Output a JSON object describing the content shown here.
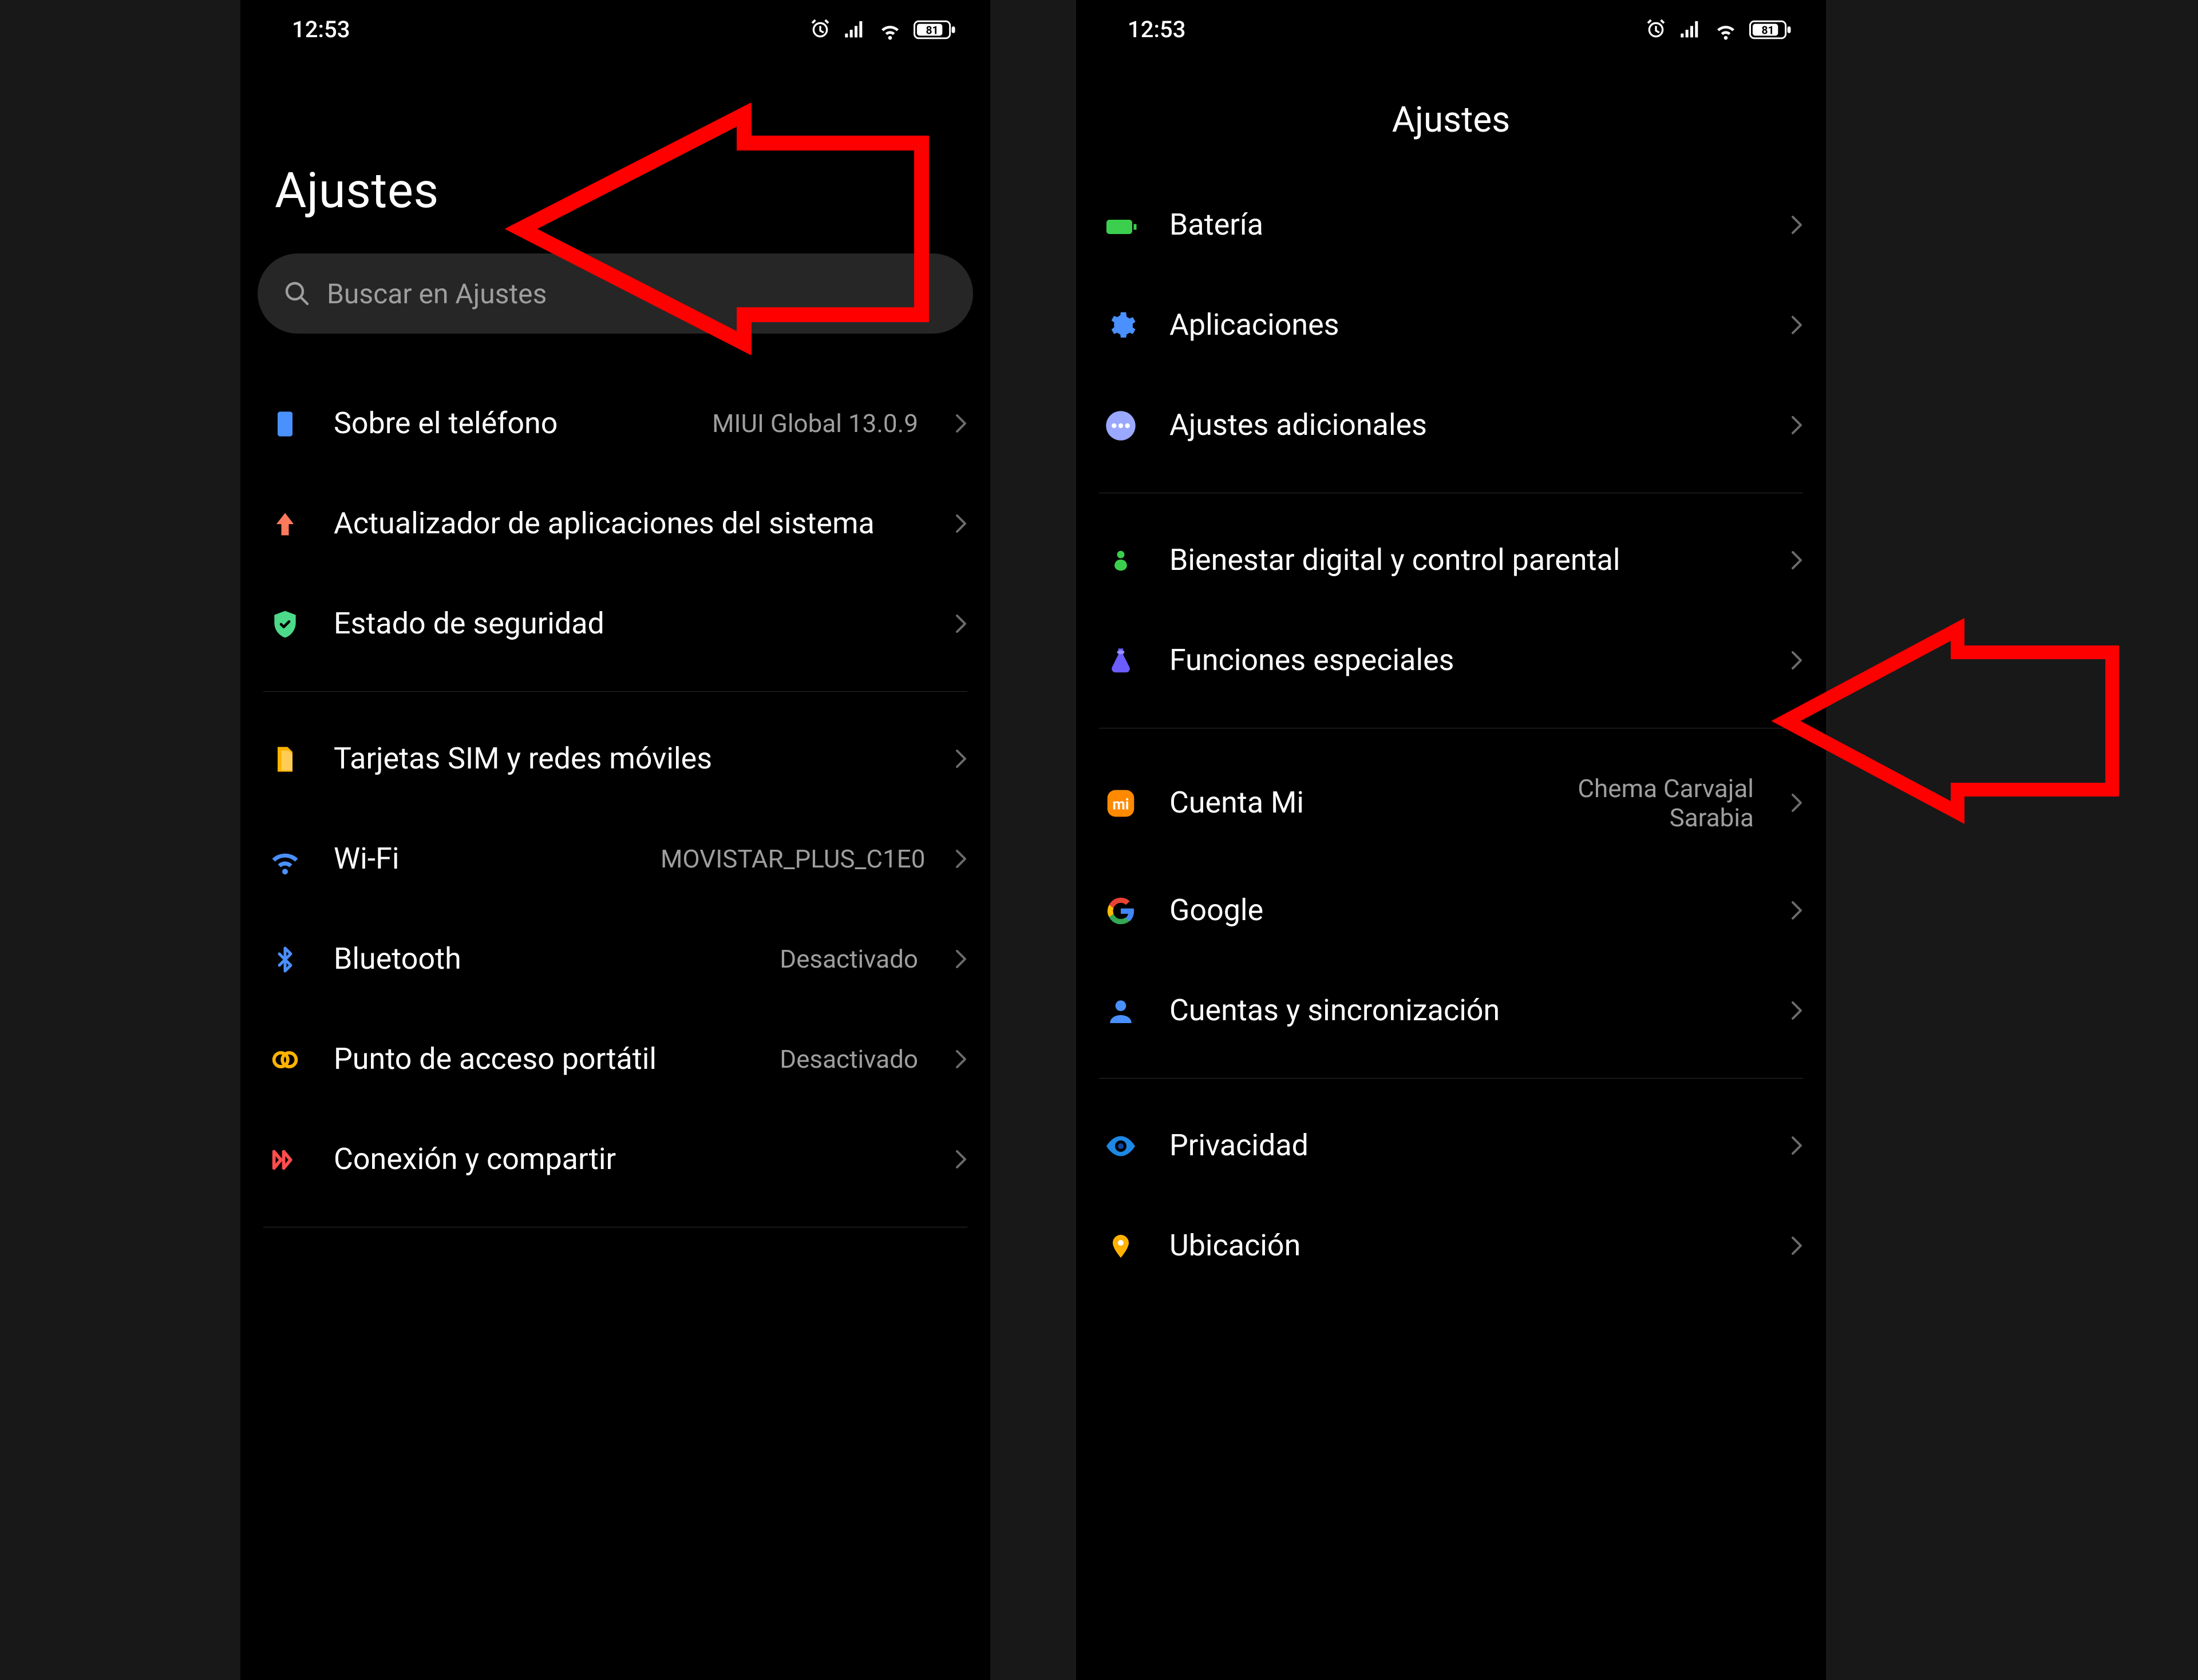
{
  "statusbar": {
    "time": "12:53",
    "battery": "81"
  },
  "phone1": {
    "title": "Ajustes",
    "search_placeholder": "Buscar en Ajustes",
    "rows": {
      "about": {
        "label": "Sobre el teléfono",
        "value": "MIUI Global 13.0.9"
      },
      "updater": {
        "label": "Actualizador de aplicaciones del sistema"
      },
      "security": {
        "label": "Estado de seguridad"
      },
      "sim": {
        "label": "Tarjetas SIM y redes móviles"
      },
      "wifi": {
        "label": "Wi-Fi",
        "value": "MOVISTAR_PLUS_C1E0"
      },
      "bluetooth": {
        "label": "Bluetooth",
        "value": "Desactivado"
      },
      "hotspot": {
        "label": "Punto de acceso portátil",
        "value": "Desactivado"
      },
      "share": {
        "label": "Conexión y compartir"
      }
    }
  },
  "phone2": {
    "title": "Ajustes",
    "rows": {
      "battery": {
        "label": "Batería"
      },
      "apps": {
        "label": "Aplicaciones"
      },
      "additional": {
        "label": "Ajustes adicionales"
      },
      "wellbeing": {
        "label": "Bienestar digital y control parental"
      },
      "special": {
        "label": "Funciones especiales"
      },
      "mi_account": {
        "label": "Cuenta Mi",
        "value": "Chema Carvajal Sarabia"
      },
      "google": {
        "label": "Google"
      },
      "accounts": {
        "label": "Cuentas y sincronización"
      },
      "privacy": {
        "label": "Privacidad"
      },
      "location": {
        "label": "Ubicación"
      }
    }
  },
  "icon_colors": {
    "about": "#4a90ff",
    "updater": "#ff7a5c",
    "security": "#4cd98a",
    "sim": "#ffb300",
    "wifi": "#4a90ff",
    "bluetooth": "#4a90ff",
    "hotspot": "#ffb300",
    "share": "#ff4d4d",
    "battery": "#3ccf4e",
    "apps": "#4a90ff",
    "additional": "#9aa8ff",
    "wellbeing": "#3ccf4e",
    "special": "#6b5dff",
    "mi_account": "#ff8a00",
    "google_g": "#4285F4",
    "accounts": "#4a90ff",
    "privacy": "#1e88e5",
    "location": "#ffb300"
  }
}
